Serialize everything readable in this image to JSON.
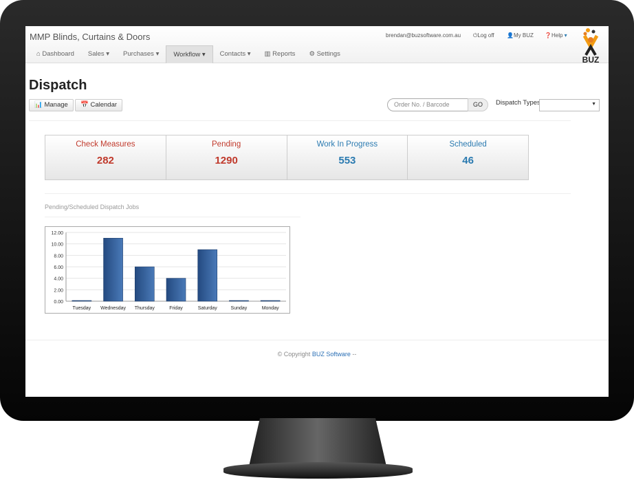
{
  "header": {
    "brand": "MMP Blinds, Curtains & Doors",
    "user_email": "brendan@buzsoftware.com.au",
    "logoff": "Log off",
    "mybuz": "My BUZ",
    "help": "Help",
    "logo_text": "BUZ"
  },
  "nav": [
    {
      "label": "Dashboard",
      "icon": "home-icon"
    },
    {
      "label": "Sales ▾"
    },
    {
      "label": "Purchases ▾"
    },
    {
      "label": "Workflow ▾",
      "active": true
    },
    {
      "label": "Contacts ▾"
    },
    {
      "label": "Reports",
      "icon": "bar-chart-icon"
    },
    {
      "label": "Settings",
      "icon": "cogs-icon"
    }
  ],
  "page": {
    "title": "Dispatch",
    "manage": "Manage",
    "calendar": "Calendar",
    "search_placeholder": "Order No. / Barcode",
    "go": "GO",
    "dispatch_types_label": "Dispatch Types",
    "dispatch_types_value": ""
  },
  "stats": [
    {
      "label": "Check Measures",
      "value": "282",
      "color": "#c0392b"
    },
    {
      "label": "Pending",
      "value": "1290",
      "color": "#c0392b"
    },
    {
      "label": "Work In Progress",
      "value": "553",
      "color": "#2a7ab0"
    },
    {
      "label": "Scheduled",
      "value": "46",
      "color": "#2a7ab0"
    }
  ],
  "chart_title": "Pending/Scheduled Dispatch Jobs",
  "chart_data": {
    "type": "bar",
    "categories": [
      "Tuesday",
      "Wednesday",
      "Thursday",
      "Friday",
      "Saturday",
      "Sunday",
      "Monday"
    ],
    "values": [
      0,
      11,
      6,
      4,
      9,
      0,
      0
    ],
    "ylim": [
      0,
      12
    ],
    "yticks": [
      "0.00",
      "2.00",
      "4.00",
      "6.00",
      "8.00",
      "10.00",
      "12.00"
    ],
    "grid": true,
    "bar_color": "#2f5b94"
  },
  "footer": {
    "copyright": "© Copyright",
    "link": "BUZ Software",
    "suffix": "--"
  }
}
